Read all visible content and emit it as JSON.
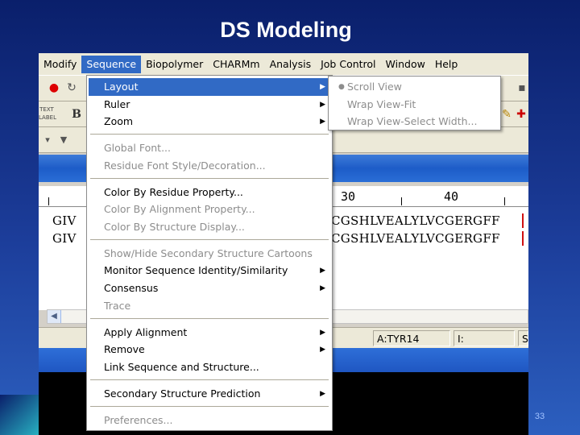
{
  "slide": {
    "title": "DS Modeling",
    "page_number": "33"
  },
  "menubar": {
    "items": [
      "Modify",
      "Sequence",
      "Biopolymer",
      "CHARMm",
      "Analysis",
      "Job Control",
      "Window",
      "Help"
    ],
    "active": "Sequence"
  },
  "toolbar": {
    "text_label_button": "TEXT LABEL",
    "bold_button": "B"
  },
  "ruler": {
    "ticks": [
      "30",
      "40"
    ]
  },
  "sequence": {
    "rows": [
      {
        "prefix": "GIV",
        "residues": "CGSHLVEALYLVCGERGFF"
      },
      {
        "prefix": "GIV",
        "residues": "CGSHLVEALYLVCGERGFF"
      }
    ],
    "highlight_color": "#d01010"
  },
  "statusbar": {
    "residue": "A:TYR14",
    "index": "I:",
    "extra": "S"
  },
  "menu": {
    "items": [
      {
        "label": "Layout",
        "submenu": true,
        "state": "selected"
      },
      {
        "label": "Ruler",
        "submenu": true,
        "state": "enabled"
      },
      {
        "label": "Zoom",
        "submenu": true,
        "state": "enabled"
      },
      {
        "label": "Global Font...",
        "submenu": false,
        "state": "disabled"
      },
      {
        "label": "Residue Font Style/Decoration...",
        "submenu": false,
        "state": "disabled"
      },
      {
        "label": "Color By Residue Property...",
        "submenu": false,
        "state": "enabled"
      },
      {
        "label": "Color By Alignment Property...",
        "submenu": false,
        "state": "disabled"
      },
      {
        "label": "Color By Structure Display...",
        "submenu": false,
        "state": "disabled"
      },
      {
        "label": "Show/Hide Secondary Structure Cartoons",
        "submenu": false,
        "state": "disabled"
      },
      {
        "label": "Monitor Sequence Identity/Similarity",
        "submenu": true,
        "state": "enabled"
      },
      {
        "label": "Consensus",
        "submenu": true,
        "state": "enabled"
      },
      {
        "label": "Trace",
        "submenu": false,
        "state": "disabled"
      },
      {
        "label": "Apply Alignment",
        "submenu": true,
        "state": "enabled"
      },
      {
        "label": "Remove",
        "submenu": true,
        "state": "enabled"
      },
      {
        "label": "Link Sequence and Structure...",
        "submenu": false,
        "state": "enabled"
      },
      {
        "label": "Secondary Structure Prediction",
        "submenu": true,
        "state": "enabled"
      },
      {
        "label": "Preferences...",
        "submenu": false,
        "state": "disabled"
      }
    ]
  },
  "layout_submenu": {
    "items": [
      {
        "label": "Scroll View",
        "checked": true
      },
      {
        "label": "Wrap View-Fit",
        "checked": false
      },
      {
        "label": "Wrap View-Select Width...",
        "checked": false
      }
    ]
  },
  "colors": {
    "slide_background": "#1c3d9a",
    "menu_highlight": "#316ac5",
    "disabled_text": "#8d8d8d"
  }
}
